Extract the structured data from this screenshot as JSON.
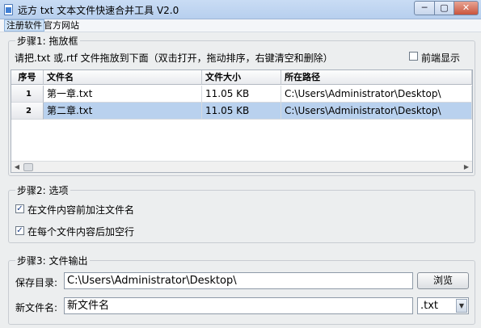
{
  "window": {
    "title": "远方 txt 文本文件快速合并工具 V2.0",
    "minimize_glyph": "─",
    "maximize_glyph": "▢",
    "close_glyph": "✕"
  },
  "menu": {
    "items": [
      {
        "label": "注册软件",
        "selected": true
      },
      {
        "label": "官方网站",
        "selected": false
      }
    ]
  },
  "step1": {
    "title": "步骤1: 拖放框",
    "instruction": "请把.txt 或.rtf 文件拖放到下面（双击打开，拖动排序，右键清空和删除）",
    "front_display": {
      "label": "前端显示",
      "checked": false
    },
    "table": {
      "columns": [
        "序号",
        "文件名",
        "文件大小",
        "所在路径"
      ],
      "rows": [
        {
          "index": "1",
          "name": "第一章.txt",
          "size": "11.05 KB",
          "path": "C:\\Users\\Administrator\\Desktop\\",
          "selected": false
        },
        {
          "index": "2",
          "name": "第二章.txt",
          "size": "11.05 KB",
          "path": "C:\\Users\\Administrator\\Desktop\\",
          "selected": true
        }
      ]
    }
  },
  "step2": {
    "title": "步骤2: 选项",
    "options": [
      {
        "label": "在文件内容前加注文件名",
        "checked": true
      },
      {
        "label": "在每个文件内容后加空行",
        "checked": true
      }
    ]
  },
  "step3": {
    "title": "步骤3: 文件输出",
    "save_dir_label": "保存目录:",
    "save_dir_value": "C:\\Users\\Administrator\\Desktop\\",
    "browse_label": "浏览",
    "new_name_label": "新文件名:",
    "new_name_value": "新文件名",
    "extension_value": ".txt"
  },
  "icons": {
    "check": "✓",
    "dropdown": "▼",
    "scroll_left": "◀",
    "scroll_right": "▶"
  }
}
